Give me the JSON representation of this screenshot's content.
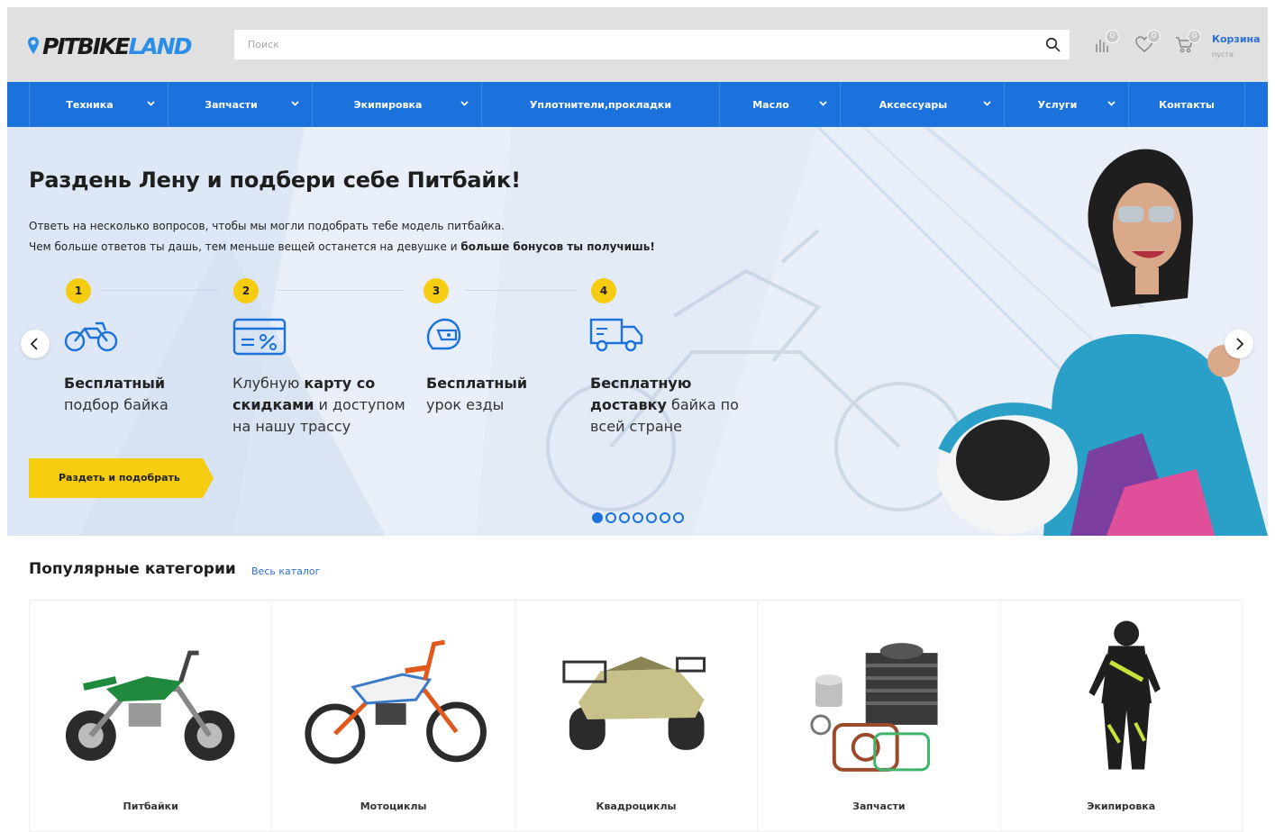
{
  "header": {
    "logo_part1": "PITBIKE",
    "logo_part2": "LAND",
    "search_placeholder": "Поиск",
    "compare_count": "0",
    "favorites_count": "0",
    "cart_count": "0",
    "cart_title": "Корзина",
    "cart_status": "пуста"
  },
  "nav": {
    "items": [
      {
        "label": "Техника"
      },
      {
        "label": "Запчасти"
      },
      {
        "label": "Экипировка"
      },
      {
        "label": "Уплотнители,прокладки"
      },
      {
        "label": "Масло"
      },
      {
        "label": "Аксессуары"
      },
      {
        "label": "Услуги"
      },
      {
        "label": "Контакты"
      }
    ]
  },
  "hero": {
    "title": "Раздень Лену и подбери себе Питбайк!",
    "line1": "Ответь на несколько вопросов, чтобы мы могли подобрать тебе модель питбайка.",
    "line2_plain": "Чем больше ответов ты дашь, тем меньше вещей останется на девушке и ",
    "line2_bold": "больше бонусов ты получишь!",
    "steps": [
      {
        "num": "1",
        "bold": "Бесплатный",
        "text": "подбор байка"
      },
      {
        "num": "2",
        "text_a": "Клубную ",
        "bold_a": "карту со",
        "bold_b": "скидками",
        "text_b": " и доступом",
        "text_c": "на нашу трассу"
      },
      {
        "num": "3",
        "bold": "Бесплатный",
        "text": "урок езды"
      },
      {
        "num": "4",
        "bold_a": "Бесплатную",
        "bold_b": "доставку",
        "text_b": " байка по",
        "text_c": "всей стране"
      }
    ],
    "cta": "Раздеть и подобрать",
    "slides_total": 7,
    "slide_active": 1
  },
  "categories": {
    "title": "Популярные категории",
    "all_link": "Весь каталог",
    "items": [
      {
        "label": "Питбайки"
      },
      {
        "label": "Мотоциклы"
      },
      {
        "label": "Квадроциклы"
      },
      {
        "label": "Запчасти"
      },
      {
        "label": "Экипировка"
      }
    ]
  },
  "colors": {
    "brand_blue": "#1b72dc",
    "accent_yellow": "#f6cc10",
    "header_gray": "#e0e0e0"
  }
}
